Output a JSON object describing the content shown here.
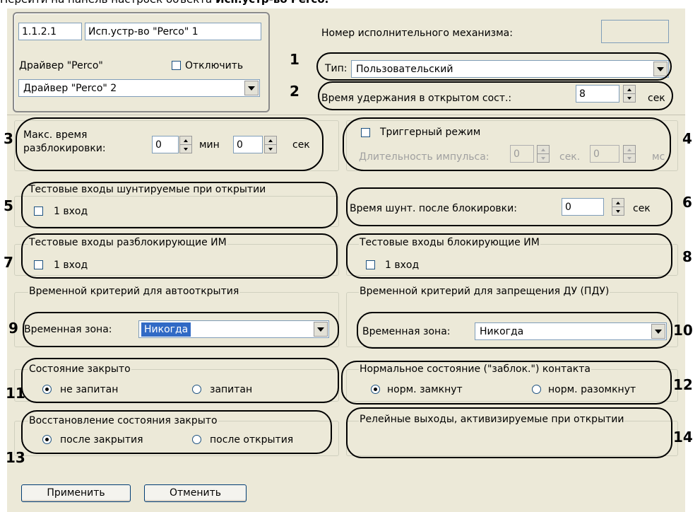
{
  "caption": {
    "prefix": "Перейти на панель настроек объекта ",
    "bold": "Исп.устр-во Perco."
  },
  "object": {
    "id": "1.1.2.1",
    "name": "Исп.устр-во \"Perco\" 1",
    "driver_label": "Драйвер \"Perco\"",
    "disable_label": "Отключить",
    "driver_value": "Драйвер \"Perco\" 2"
  },
  "mechanism_number_label": "Номер исполнительного механизма:",
  "mechanism_number_value": "",
  "type": {
    "label": "Тип:",
    "value": "Пользовательский"
  },
  "hold_open": {
    "label": "Время удержания в открытом сост.:",
    "value": "8",
    "unit": "сек"
  },
  "max_unlock": {
    "label1": "Макс. время",
    "label2": "разблокировки:",
    "min_value": "0",
    "min_unit": "мин",
    "sec_value": "0",
    "sec_unit": "сек"
  },
  "trigger": {
    "label": "Триггерный режим",
    "pulse_label": "Длительность импульса:",
    "sec_value": "0",
    "sec_unit": "сек.",
    "ms_value": "0",
    "ms_unit": "мс"
  },
  "shunted_inputs": {
    "title": "Тестовые входы шунтируемые при открытии",
    "item": "1 вход"
  },
  "shunt_time": {
    "label": "Время шунт. после блокировки:",
    "value": "0",
    "unit": "сек"
  },
  "unlocking_inputs": {
    "title": "Тестовые входы разблокирующие ИМ",
    "item": "1 вход"
  },
  "blocking_inputs": {
    "title": "Тестовые входы блокирующие ИМ",
    "item": "1 вход"
  },
  "auto_open": {
    "title": "Временной критерий для автооткрытия",
    "zone_label": "Временная зона:",
    "zone_value": "Никогда"
  },
  "remote_ban": {
    "title": "Временной критерий для запрещения ДУ (ПДУ)",
    "zone_label": "Временная зона:",
    "zone_value": "Никогда"
  },
  "closed_state": {
    "title": "Состояние закрыто",
    "opt1": "не запитан",
    "opt2": "запитан",
    "selected": "не запитан"
  },
  "contact_state": {
    "title": "Нормальное состояние (\"заблок.\") контакта",
    "opt1": "норм. замкнут",
    "opt2": "норм. разомкнут",
    "selected": "норм. замкнут"
  },
  "restore_state": {
    "title": "Восстановление состояния закрыто",
    "opt1": "после закрытия",
    "opt2": "после открытия",
    "selected": "после закрытия"
  },
  "relay_outputs": {
    "title": "Релейные выходы, активизируемые при открытии"
  },
  "buttons": {
    "apply": "Применить",
    "cancel": "Отменить"
  },
  "markers": [
    "1",
    "2",
    "3",
    "4",
    "5",
    "6",
    "7",
    "8",
    "9",
    "10",
    "11",
    "12",
    "13",
    "14"
  ]
}
